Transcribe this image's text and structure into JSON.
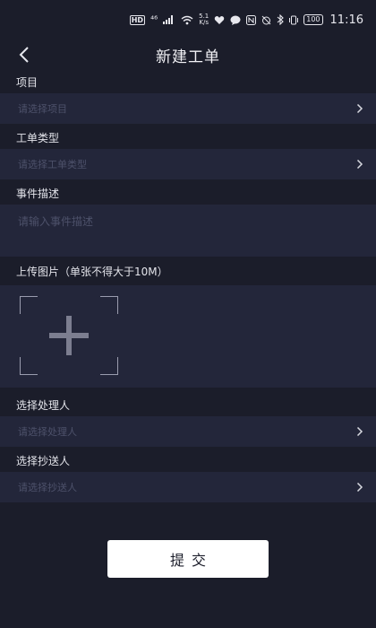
{
  "status_bar": {
    "hd": "HD",
    "network": "⁴⁶",
    "speed_value": "5.1",
    "speed_unit": "K/s",
    "battery": "100",
    "time": "11:16"
  },
  "header": {
    "title": "新建工单"
  },
  "form": {
    "project": {
      "label": "项目",
      "placeholder": "请选择项目"
    },
    "ticket_type": {
      "label": "工单类型",
      "placeholder": "请选择工单类型"
    },
    "description": {
      "label": "事件描述",
      "placeholder": "请输入事件描述"
    },
    "upload": {
      "label": "上传图片（单张不得大于10M）"
    },
    "handler": {
      "label": "选择处理人",
      "placeholder": "请选择处理人"
    },
    "cc": {
      "label": "选择抄送人",
      "placeholder": "请选择抄送人"
    }
  },
  "submit_label": "提交",
  "colors": {
    "background": "#1b1d2a",
    "field_background": "#23263a",
    "placeholder": "#4d516a",
    "button": "#ffffff"
  }
}
